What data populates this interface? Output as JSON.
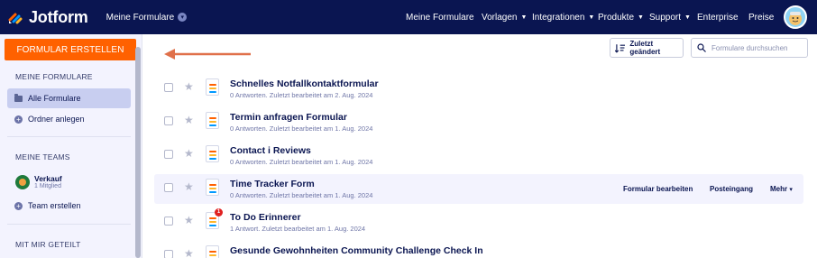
{
  "app": {
    "logo_text": "Jotform",
    "workspace_label": "Meine Formulare"
  },
  "nav": {
    "items": [
      {
        "label": "Meine Formulare",
        "dropdown": false
      },
      {
        "label": "Vorlagen",
        "dropdown": true
      },
      {
        "label": "Integrationen",
        "dropdown": true
      },
      {
        "label": "Produkte",
        "dropdown": true
      },
      {
        "label": "Support",
        "dropdown": true
      },
      {
        "label": "Enterprise",
        "dropdown": false
      },
      {
        "label": "Preise",
        "dropdown": false
      }
    ]
  },
  "sidebar": {
    "create_button": "FORMULAR ERSTELLEN",
    "my_forms_heading": "MEINE FORMULARE",
    "all_forms": "Alle Formulare",
    "create_folder": "Ordner anlegen",
    "my_teams_heading": "MEINE TEAMS",
    "team": {
      "name": "Verkauf",
      "members": "1 Mitglied"
    },
    "create_team": "Team erstellen",
    "shared_heading": "MIT MIR GETEILT"
  },
  "toolbar": {
    "sort_label": "Zuletzt geändert",
    "search_placeholder": "Formulare durchsuchen"
  },
  "forms": [
    {
      "title": "Schnelles Notfallkontaktformular",
      "meta": "0 Antworten. Zuletzt bearbeitet am 2. Aug. 2024",
      "notification": ""
    },
    {
      "title": "Termin anfragen Formular",
      "meta": "0 Antworten. Zuletzt bearbeitet am 1. Aug. 2024",
      "notification": ""
    },
    {
      "title": "Contact i Reviews",
      "meta": "0 Antworten. Zuletzt bearbeitet am 1. Aug. 2024",
      "notification": ""
    },
    {
      "title": "Time Tracker Form",
      "meta": "0 Antworten. Zuletzt bearbeitet am 1. Aug. 2024",
      "notification": ""
    },
    {
      "title": "To Do Erinnerer",
      "meta": "1 Antwort. Zuletzt bearbeitet am 1. Aug. 2024",
      "notification": "1"
    },
    {
      "title": "Gesunde Gewohnheiten Community Challenge Check In",
      "meta": "",
      "notification": ""
    }
  ],
  "row_actions": {
    "edit": "Formular bearbeiten",
    "inbox": "Posteingang",
    "more": "Mehr"
  },
  "colors": {
    "navy": "#0a1551",
    "accent_orange": "#ff6100",
    "sidebar_bg": "#f3f3fe",
    "active_item": "#c8cef0"
  }
}
